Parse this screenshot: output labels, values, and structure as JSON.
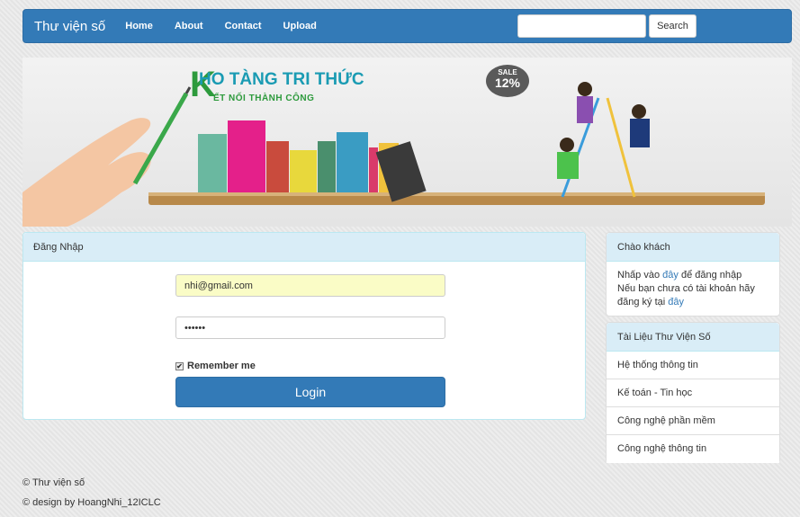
{
  "navbar": {
    "brand": "Thư viện số",
    "links": [
      "Home",
      "About",
      "Contact",
      "Upload"
    ],
    "search_value": "",
    "search_button": "Search"
  },
  "banner": {
    "title_initial": "K",
    "title_rest": "HO TÀNG TRI THỨC",
    "subtitle": "ẾT NỐI THÀNH CÔNG",
    "sale_label": "SALE",
    "sale_value": "12%"
  },
  "login": {
    "heading": "Đăng Nhập",
    "email_value": "nhi@gmail.com",
    "password_value": "••••••",
    "remember_label": "Remember me",
    "remember_checked": true,
    "submit_label": "Login"
  },
  "welcome": {
    "heading": "Chào khách",
    "line1_prefix": "Nhấp vào ",
    "line1_link": "đây",
    "line1_suffix": " để đăng nhập",
    "line2": "Nếu bạn chưa có tài khoản hãy",
    "line3_prefix": "đăng ký tại ",
    "line3_link": "đây"
  },
  "documents": {
    "heading": "Tài Liệu Thư Viện Số",
    "items": [
      "Hệ thống thông tin",
      "Kế toán - Tin học",
      "Công nghệ phần mềm",
      "Công nghệ thông tin"
    ]
  },
  "footer": {
    "line1": "© Thư viện số",
    "line2": "© design by HoangNhi_12ICLC"
  },
  "colors": {
    "primary": "#337ab7",
    "panel_heading_bg": "#d9edf7",
    "autofill_bg": "#fafcc6"
  }
}
